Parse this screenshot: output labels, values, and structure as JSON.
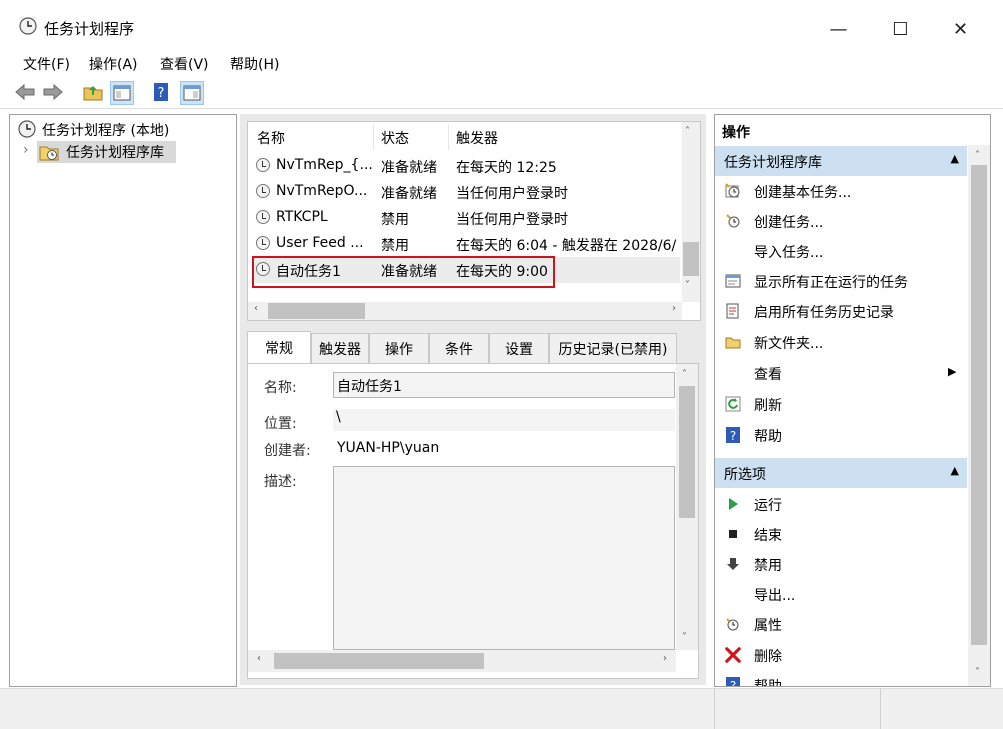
{
  "window": {
    "title": "任务计划程序",
    "minimize": "—",
    "maximize": "☐",
    "close": "✕"
  },
  "menu": [
    "文件(F)",
    "操作(A)",
    "查看(V)",
    "帮助(H)"
  ],
  "tree": {
    "root": "任务计划程序 (本地)",
    "child": "任务计划程序库",
    "expander": "›"
  },
  "task_list": {
    "columns": [
      "名称",
      "状态",
      "触发器"
    ],
    "rows": [
      {
        "name": "NvTmRep_{...",
        "status": "准备就绪",
        "trigger": "在每天的 12:25"
      },
      {
        "name": "NvTmRepO...",
        "status": "准备就绪",
        "trigger": "当任何用户登录时"
      },
      {
        "name": "RTKCPL",
        "status": "禁用",
        "trigger": "当任何用户登录时"
      },
      {
        "name": "User Feed ...",
        "status": "禁用",
        "trigger": "在每天的 6:04 - 触发器在 2028/6/"
      },
      {
        "name": "自动任务1",
        "status": "准备就绪",
        "trigger": "在每天的 9:00"
      }
    ]
  },
  "tabs": [
    "常规",
    "触发器",
    "操作",
    "条件",
    "设置",
    "历史记录(已禁用)"
  ],
  "general": {
    "name_label": "名称:",
    "name_value": "自动任务1",
    "location_label": "位置:",
    "location_value": "\\",
    "author_label": "创建者:",
    "author_value": "YUAN-HP\\yuan",
    "desc_label": "描述:"
  },
  "actions_panel": {
    "title": "操作",
    "section1": "任务计划程序库",
    "section1_items": [
      "创建基本任务...",
      "创建任务...",
      "导入任务...",
      "显示所有正在运行的任务",
      "启用所有任务历史记录",
      "新文件夹...",
      "查看",
      "刷新",
      "帮助"
    ],
    "section2": "所选项",
    "section2_items": [
      "运行",
      "结束",
      "禁用",
      "导出...",
      "属性",
      "删除",
      "帮助"
    ]
  },
  "scroll": {
    "up": "˄",
    "down": "˅",
    "left": "‹",
    "right": "›",
    "section_collapse": "▲",
    "submenu": "▶"
  },
  "colors": {
    "selection_box": "#d0121b",
    "section_header": "#cde0f1",
    "run_icon": "#2ea043",
    "delete_icon": "#d0121b",
    "help_icon": "#2b5cb8"
  }
}
